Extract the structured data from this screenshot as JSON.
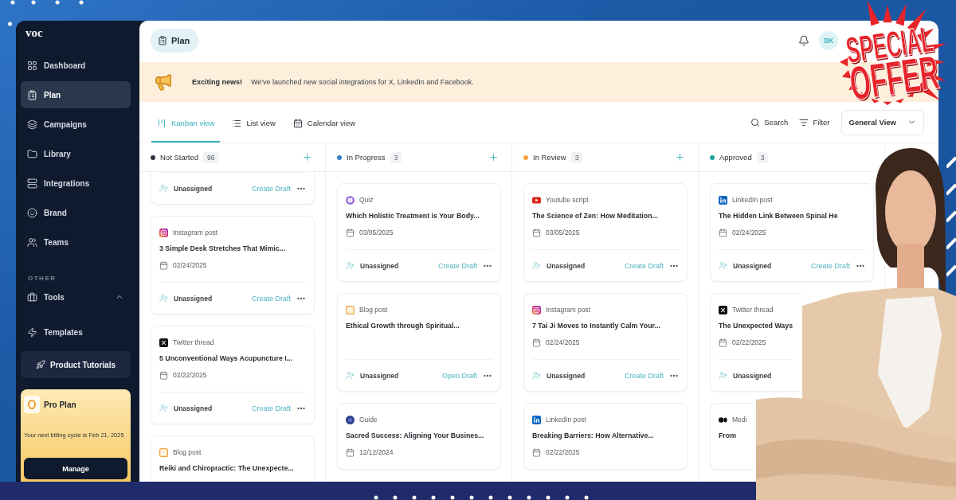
{
  "sidebar": {
    "logo": "voc",
    "items": [
      {
        "label": "Dashboard",
        "selected": false
      },
      {
        "label": "Plan",
        "selected": true
      },
      {
        "label": "Campaigns",
        "selected": false
      },
      {
        "label": "Library",
        "selected": false
      },
      {
        "label": "Integrations",
        "selected": false
      },
      {
        "label": "Brand",
        "selected": false
      },
      {
        "label": "Teams",
        "selected": false
      }
    ],
    "section_label": "OTHER",
    "other_items": [
      {
        "label": "Tools",
        "kind": "group",
        "expanded": true,
        "selected": false
      },
      {
        "label": "Templates",
        "kind": "link",
        "selected": false
      }
    ],
    "tutorials_button": "Product Tutorials",
    "plan_card": {
      "title": "Pro Plan",
      "note": "Your next billing cycle is Feb 21, 2025",
      "button": "Manage"
    }
  },
  "topbar": {
    "page_title": "Plan",
    "avatar": "SK"
  },
  "banner": {
    "headline": "Exciting news!",
    "message": "We've launched new social integrations for X, LinkedIn and Facebook."
  },
  "views": [
    {
      "label": "Kanban view",
      "selected": true
    },
    {
      "label": "List view",
      "selected": false
    },
    {
      "label": "Calendar view",
      "selected": false
    }
  ],
  "toolbar": {
    "search": "Search",
    "filter": "Filter",
    "view_select": "General View"
  },
  "columns": [
    {
      "name": "Not Started",
      "count": "96",
      "color": "#2f3440",
      "add_button": true,
      "cards": [
        {
          "assignee": "Unassigned",
          "action": "Create Draft"
        },
        {
          "type": {
            "kind": "instagram",
            "label": "Instagram post"
          },
          "title": "3 Simple Desk Stretches That Mimic...",
          "date": "02/24/2025",
          "assignee": "Unassigned",
          "action": "Create Draft"
        },
        {
          "type": {
            "kind": "twitter",
            "label": "Twitter thread"
          },
          "title": "5 Unconventional Ways Acupuncture I...",
          "date": "02/22/2025",
          "assignee": "Unassigned",
          "action": "Create Draft"
        },
        {
          "type": {
            "kind": "blog",
            "label": "Blog post"
          },
          "title": "Reiki and Chiropractic: The Unexpecte..."
        }
      ]
    },
    {
      "name": "In Progress",
      "count": "3",
      "color": "#3a80c9",
      "add_button": true,
      "cards": [
        {
          "type": {
            "kind": "quiz",
            "label": "Quiz"
          },
          "title": "Which Holistic Treatment is Your Body...",
          "date": "03/05/2025",
          "assignee": "Unassigned",
          "action": "Create Draft"
        },
        {
          "type": {
            "kind": "blog",
            "label": "Blog post"
          },
          "title": "Ethical Growth through Spiritual...",
          "assignee": "Unassigned",
          "action": "Open Draft"
        },
        {
          "type": {
            "kind": "guide",
            "label": "Guide"
          },
          "title": "Sacred Success: Aligning Your Busines...",
          "date": "12/12/2024"
        }
      ]
    },
    {
      "name": "In Review",
      "count": "3",
      "color": "#f0a33b",
      "add_button": true,
      "cards": [
        {
          "type": {
            "kind": "youtube",
            "label": "Youtube script"
          },
          "title": "The Science of Zen: How Meditation...",
          "date": "03/05/2025",
          "assignee": "Unassigned",
          "action": "Create Draft"
        },
        {
          "type": {
            "kind": "instagram",
            "label": "Instagram post"
          },
          "title": "7 Tai Ji Moves to Instantly Calm Your...",
          "date": "02/24/2025",
          "assignee": "Unassigned",
          "action": "Create Draft"
        },
        {
          "type": {
            "kind": "linkedin",
            "label": "LinkedIn post"
          },
          "title": "Breaking Barriers: How Alternative...",
          "date": "02/22/2025"
        }
      ]
    },
    {
      "name": "Approved",
      "count": "3",
      "color": "#1fa597",
      "add_button": false,
      "cards": [
        {
          "type": {
            "kind": "linkedin",
            "label": "LinkedIn post"
          },
          "title": "The Hidden Link Between Spinal He",
          "date": "02/24/2025",
          "assignee": "Unassigned",
          "action": "Create Draft"
        },
        {
          "type": {
            "kind": "twitter",
            "label": "Twitter thread"
          },
          "title": "The Unexpected Ways",
          "date": "02/22/2025",
          "assignee": "Unassigned"
        },
        {
          "type": {
            "kind": "medium",
            "label": "Medi"
          },
          "title": "From"
        }
      ]
    }
  ],
  "promo": {
    "lines": [
      "SPECIAL",
      "OFFER"
    ]
  }
}
